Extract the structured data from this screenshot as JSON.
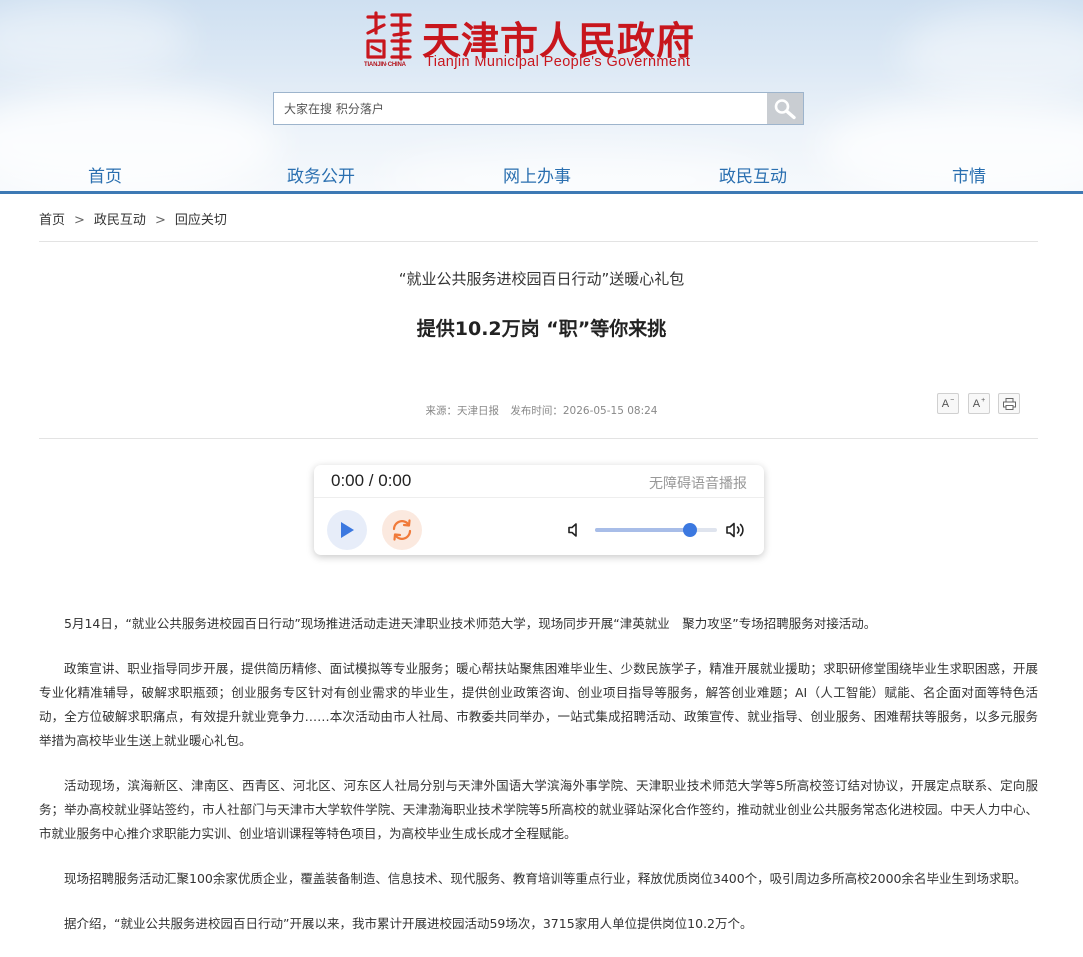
{
  "header": {
    "site_title": "天津市人民政府",
    "site_title_en": "Tianjin Municipal People's Government",
    "seal_text": "TIANJIN·CHINA",
    "brand_color": "#c8161d",
    "search": {
      "placeholder": "大家在搜 积分落户",
      "button_icon": "search-icon"
    },
    "nav": [
      "首页",
      "政务公开",
      "网上办事",
      "政民互动",
      "市情"
    ]
  },
  "breadcrumb": [
    "首页",
    "政民互动",
    "回应关切"
  ],
  "article": {
    "subtitle": "“就业公共服务进校园百日行动”送暖心礼包",
    "title": "提供10.2万岗 “职”等你来挑",
    "source_label": "来源：天津日报",
    "published_label": "发布时间：2026-05-15 08:24",
    "tools": {
      "font_decrease": "A",
      "font_increase": "A",
      "print_icon": "print-icon"
    },
    "paragraphs": [
      "5月14日，“就业公共服务进校园百日行动”现场推进活动走进天津职业技术师范大学，现场同步开展“津英就业　聚力攻坚”专场招聘服务对接活动。",
      "政策宣讲、职业指导同步开展，提供简历精修、面试模拟等专业服务；暖心帮扶站聚焦困难毕业生、少数民族学子，精准开展就业援助；求职研修堂围绕毕业生求职困惑，开展专业化精准辅导，破解求职瓶颈；创业服务专区针对有创业需求的毕业生，提供创业政策咨询、创业项目指导等服务，解答创业难题；AI（人工智能）赋能、名企面对面等特色活动，全方位破解求职痛点，有效提升就业竞争力……本次活动由市人社局、市教委共同举办，一站式集成招聘活动、政策宣传、就业指导、创业服务、困难帮扶等服务，以多元服务举措为高校毕业生送上就业暖心礼包。",
      "活动现场，滨海新区、津南区、西青区、河北区、河东区人社局分别与天津外国语大学滨海外事学院、天津职业技术师范大学等5所高校签订结对协议，开展定点联系、定向服务；举办高校就业驿站签约，市人社部门与天津市大学软件学院、天津渤海职业技术学院等5所高校的就业驿站深化合作签约，推动就业创业公共服务常态化进校园。中天人力中心、市就业服务中心推介求职能力实训、创业培训课程等特色项目，为高校毕业生成长成才全程赋能。",
      "现场招聘服务活动汇聚100余家优质企业，覆盖装备制造、信息技术、现代服务、教育培训等重点行业，释放优质岗位3400个，吸引周边多所高校2000余名毕业生到场求职。",
      "据介绍，“就业公共服务进校园百日行动”开展以来，我市累计开展进校园活动59场次，3715家用人单位提供岗位10.2万个。"
    ]
  },
  "player": {
    "time": "0:00 / 0:00",
    "label": "无障碍语音播报",
    "volume": 0.78,
    "play_icon": "play-icon",
    "loop_icon": "loop-icon",
    "accent": "#3b78e0"
  }
}
